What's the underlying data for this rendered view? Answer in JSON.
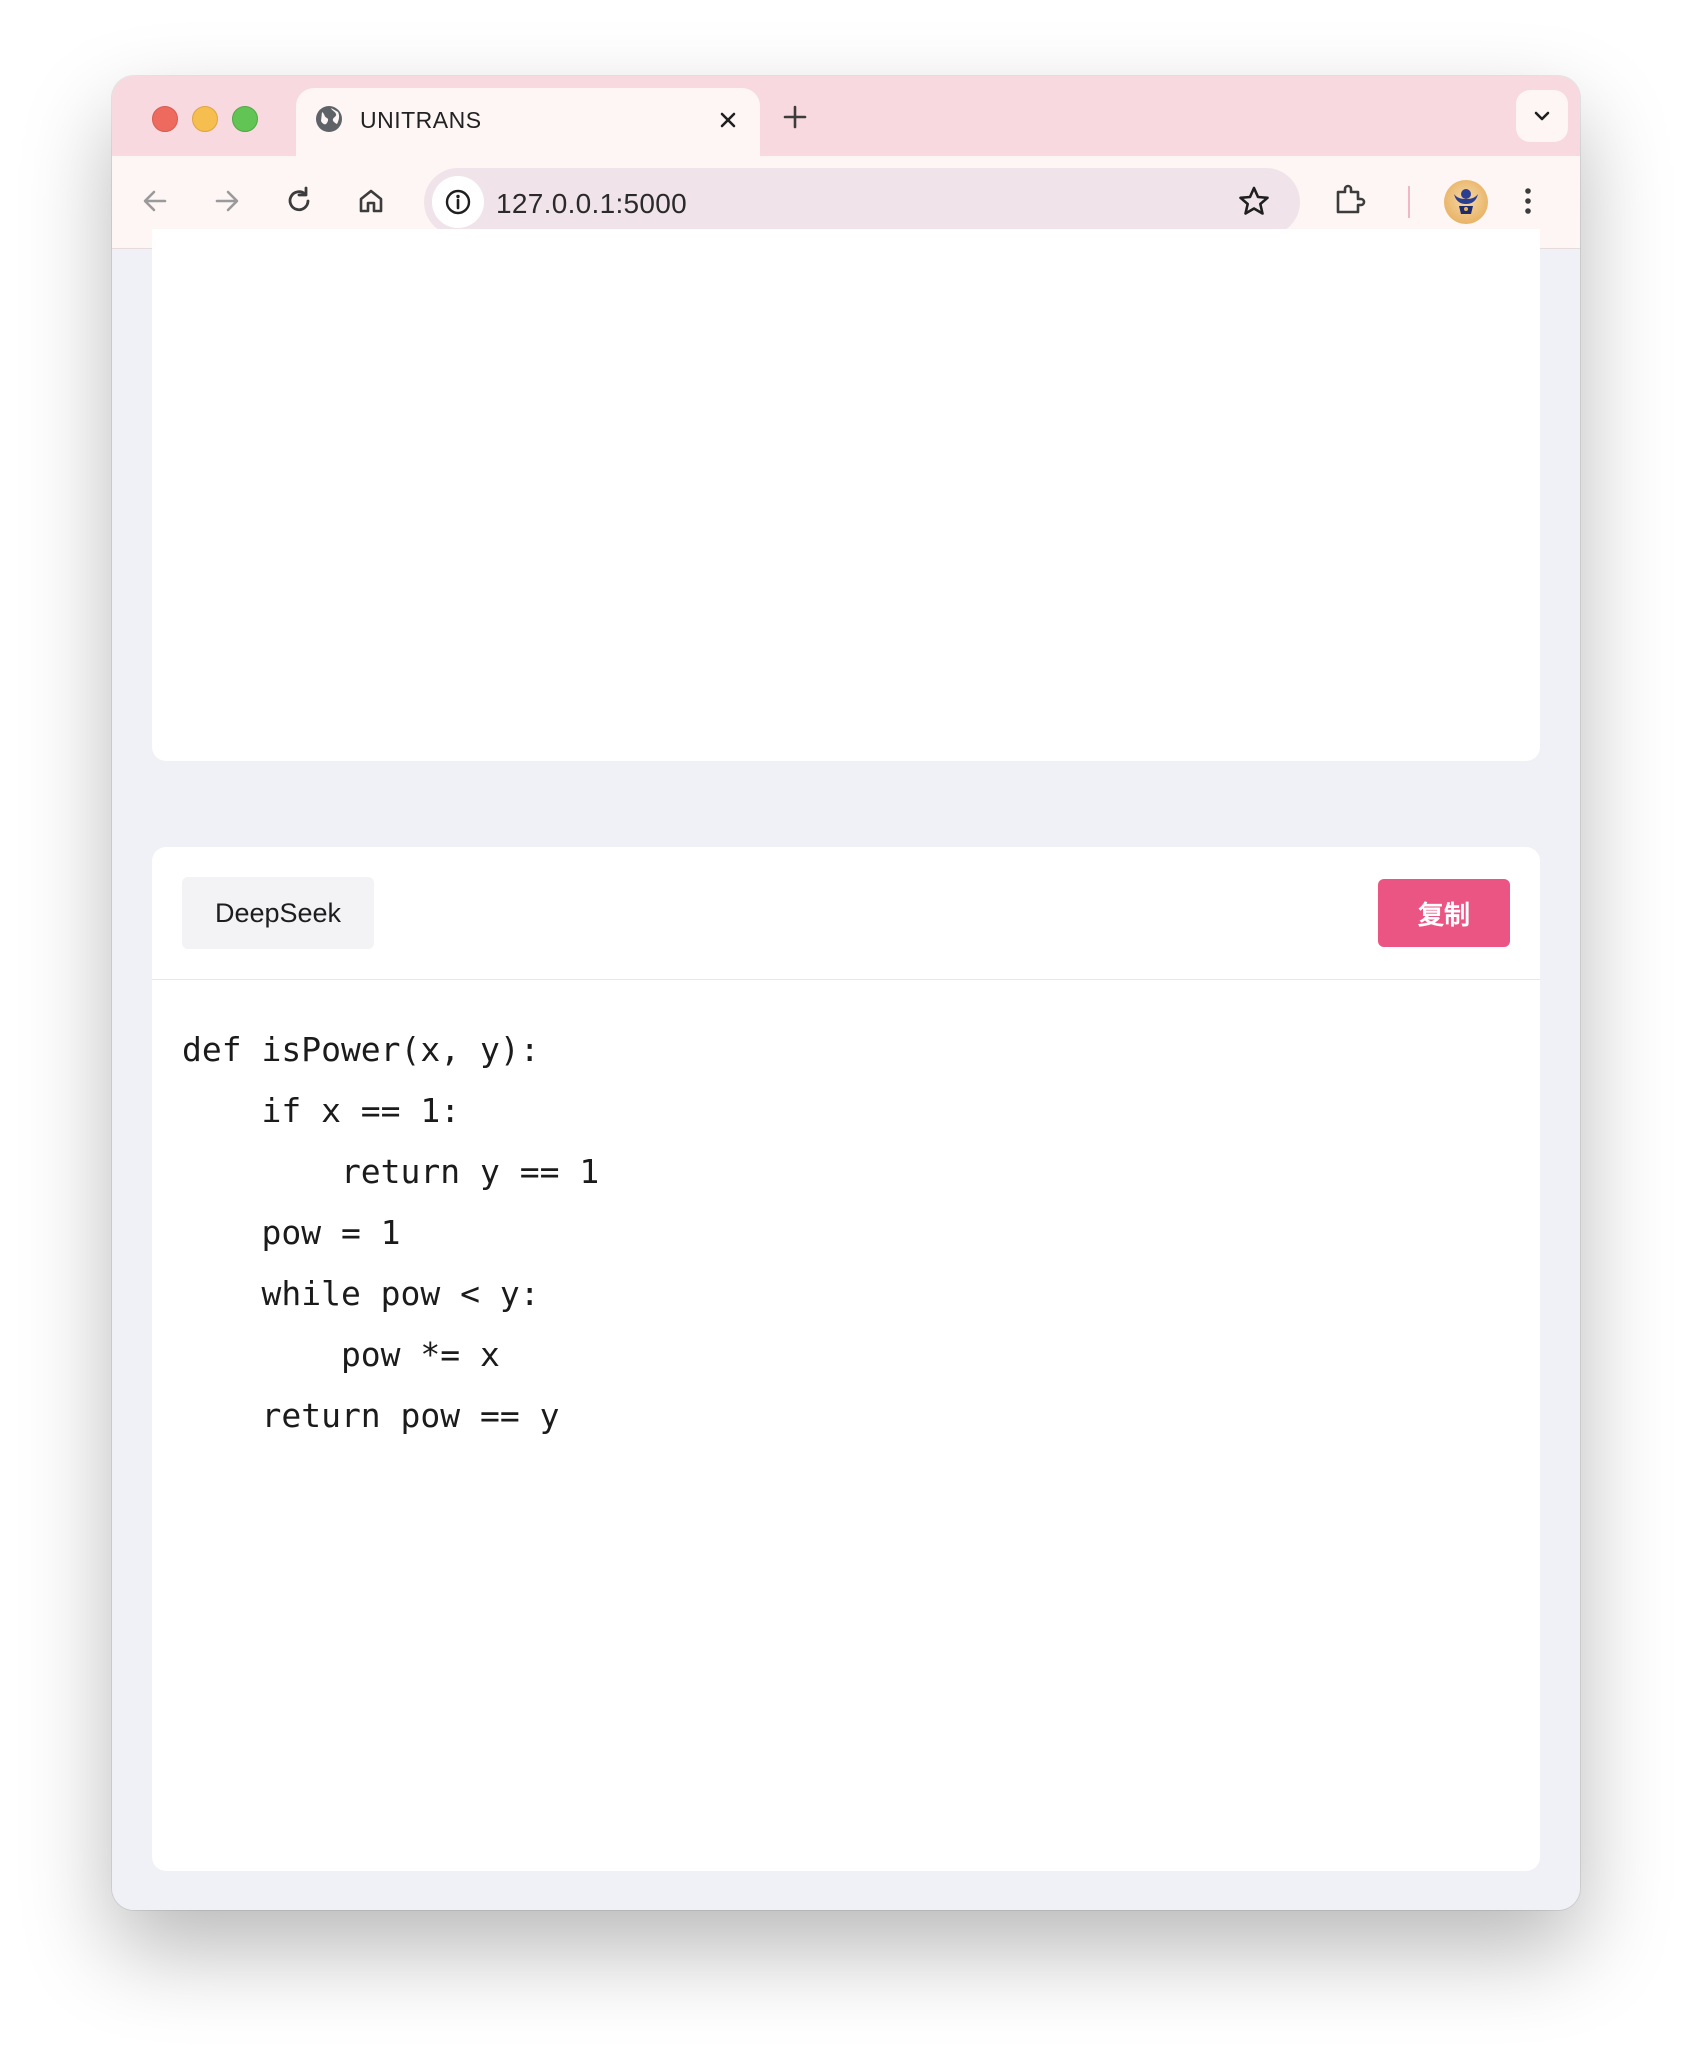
{
  "browser": {
    "tab_title": "UNITRANS",
    "url": "127.0.0.1:5000"
  },
  "result_card": {
    "model_label": "DeepSeek",
    "copy_button_label": "复制",
    "code_lines": [
      "def isPower(x, y):",
      "    if x == 1:",
      "        return y == 1",
      "    pow = 1",
      "    while pow < y:",
      "        pow *= x",
      "    return pow == y"
    ]
  },
  "colors": {
    "tabbar_bg": "#f7d9df",
    "copy_button": "#ea5584",
    "page_bg": "#f0f1f6"
  },
  "icons": [
    "globe-icon",
    "close-icon",
    "plus-icon",
    "chevron-down-icon",
    "back-arrow-icon",
    "forward-arrow-icon",
    "reload-icon",
    "home-icon",
    "info-icon",
    "star-icon",
    "extensions-icon",
    "more-vert-icon"
  ]
}
